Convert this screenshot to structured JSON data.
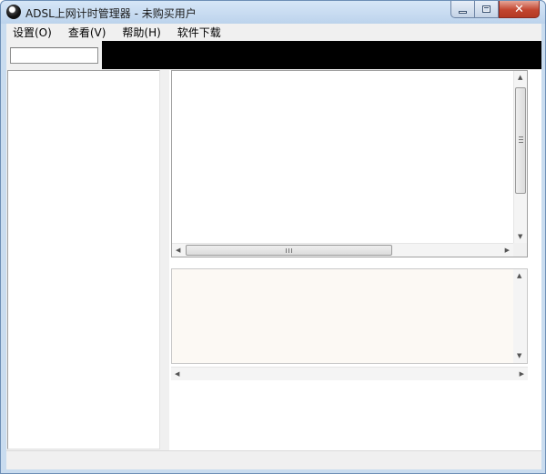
{
  "window": {
    "title": "ADSL上网计时管理器 - 未购买用户"
  },
  "menu": {
    "items": [
      "设置(O)",
      "查看(V)",
      "帮助(H)",
      "软件下载"
    ]
  },
  "toolbar": {
    "status_input_value": ""
  },
  "icons": {
    "app": "app-logo-icon",
    "minimize": "minimize-icon",
    "maximize": "maximize-icon",
    "close": "close-icon"
  },
  "colors": {
    "title_bar": "#bcd3ec",
    "close_button": "#c2452f",
    "black_panel": "#000000",
    "log_background": "#fcf9f4"
  }
}
